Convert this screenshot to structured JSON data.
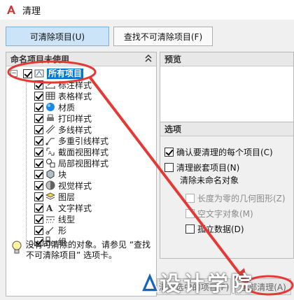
{
  "window": {
    "title": "清理"
  },
  "tabs": {
    "purgeable": "可清除项目(U)",
    "nonpurgeable": "查找不可清除项目(F)"
  },
  "tree_panel": {
    "header": "命名项目未使用",
    "root_label": "所有项目",
    "items": [
      {
        "label": "标注样式",
        "icon": "dimension-style-icon"
      },
      {
        "label": "表格样式",
        "icon": "table-style-icon"
      },
      {
        "label": "材质",
        "icon": "material-sphere-icon"
      },
      {
        "label": "打印样式",
        "icon": "plot-style-icon"
      },
      {
        "label": "多线样式",
        "icon": "multiline-style-icon"
      },
      {
        "label": "多重引线样式",
        "icon": "multileader-style-icon"
      },
      {
        "label": "截面视图样式",
        "icon": "section-view-style-icon"
      },
      {
        "label": "局部视图样式",
        "icon": "detail-view-style-icon"
      },
      {
        "label": "块",
        "icon": "block-icon"
      },
      {
        "label": "视觉样式",
        "icon": "visual-style-icon"
      },
      {
        "label": "图层",
        "icon": "layer-icon"
      },
      {
        "label": "文字样式",
        "icon": "text-style-icon"
      },
      {
        "label": "线型",
        "icon": "linetype-icon"
      },
      {
        "label": "形",
        "icon": "shape-icon"
      },
      {
        "label": "组",
        "icon": "group-icon"
      }
    ],
    "hint": "没有可清除的对象。请参见 “查找不可清除项目” 选项卡。"
  },
  "preview_panel": {
    "header": "预览"
  },
  "options_panel": {
    "header": "选项",
    "confirm_each": "确认要清理的每个项目(C)",
    "purge_nested": "清理嵌套项目(N)",
    "unnamed_group": "清除未命名对象",
    "zero_length": "长度为零的几何图形(Z)",
    "empty_text": "空文字对象(M)",
    "orphan_data": "孤立数据(D)"
  },
  "bottom_buttons": {
    "purge_checked": "清除选中的项目(P)",
    "purge_all": "全部清理(A)"
  },
  "watermark": {
    "text": "设计学院"
  },
  "colors": {
    "accent": "#0078d7",
    "annotation": "#e53935",
    "active_tab": "#cce4f7"
  }
}
